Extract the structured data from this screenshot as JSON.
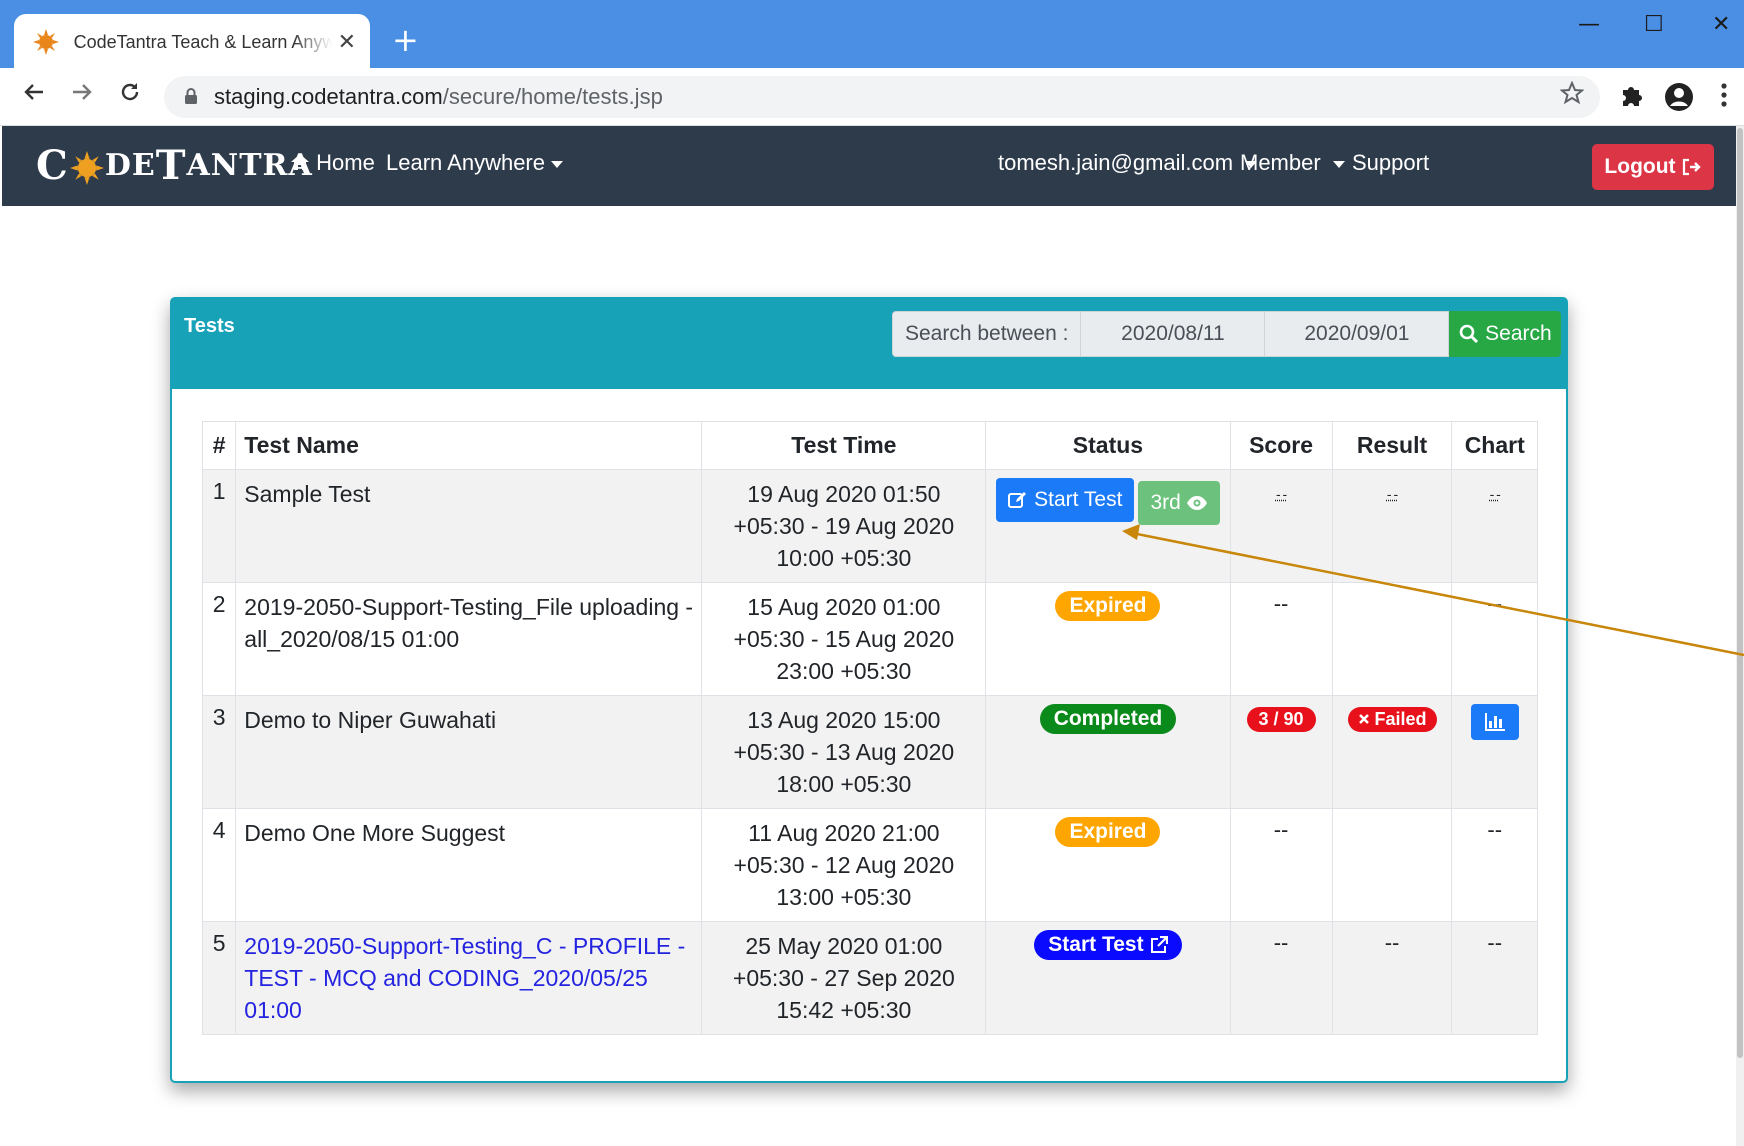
{
  "browser": {
    "tab_title": "CodeTantra Teach & Learn Anywhere",
    "tab_close": "✕",
    "new_tab": "+",
    "url_host": "staging.codetantra.com",
    "url_path": "/secure/home/tests.jsp",
    "window_controls": [
      "—",
      "☐",
      "✕"
    ]
  },
  "navbar": {
    "logo": {
      "c": "C",
      "de": "DE",
      "t": "T",
      "antra": "ANTRA"
    },
    "home": "Home",
    "learn": "Learn Anywhere",
    "user": "tomesh.jain@gmail.com",
    "member": "Member",
    "support": "Support",
    "logout": "Logout"
  },
  "panel": {
    "title": "Tests",
    "search_label": "Search between :",
    "date_from": "2020/08/11",
    "date_to": "2020/09/01",
    "search_button": "Search"
  },
  "table": {
    "headers": [
      "#",
      "Test Name",
      "Test Time",
      "Status",
      "Score",
      "Result",
      "Chart"
    ],
    "rows": [
      {
        "num": "1",
        "name": "Sample Test",
        "time": "19 Aug 2020 01:50 +05:30 - 19 Aug 2020 10:00 +05:30",
        "start_label": "Start Test",
        "view_label": "3rd",
        "score": "- -",
        "result": "- -",
        "chart": "- -"
      },
      {
        "num": "2",
        "name": "2019-2050-Support-Testing_File uploading - all_2020/08/15 01:00",
        "time": "15 Aug 2020 01:00 +05:30 - 15 Aug 2020 23:00 +05:30",
        "status": "Expired",
        "score": "--",
        "result": "",
        "chart": "--"
      },
      {
        "num": "3",
        "name": "Demo to Niper Guwahati",
        "time": "13 Aug 2020 15:00 +05:30 - 13 Aug 2020 18:00 +05:30",
        "status": "Completed",
        "score": "3 / 90",
        "result": "Failed"
      },
      {
        "num": "4",
        "name": "Demo One More Suggest",
        "time": "11 Aug 2020 21:00 +05:30 - 12 Aug 2020 13:00 +05:30",
        "status": "Expired",
        "score": "--",
        "result": "",
        "chart": "--"
      },
      {
        "num": "5",
        "name": "2019-2050-Support-Testing_C - PROFILE - TEST - MCQ and CODING_2020/05/25 01:00",
        "time": "25 May 2020 01:00 +05:30 - 27 Sep 2020 15:42 +05:30",
        "status": "Start Test",
        "score": "--",
        "result": "--",
        "chart": "--"
      }
    ]
  },
  "colors": {
    "titlebar": "#4a8fe4",
    "navbar": "#2e3b4b",
    "panel_header": "#17a2b8",
    "logout": "#dc3545",
    "search": "#28a745",
    "expired": "#ffa500",
    "completed": "#0a8a1a",
    "failed": "#e8101b",
    "annotation_arrow": "#c8860a"
  }
}
